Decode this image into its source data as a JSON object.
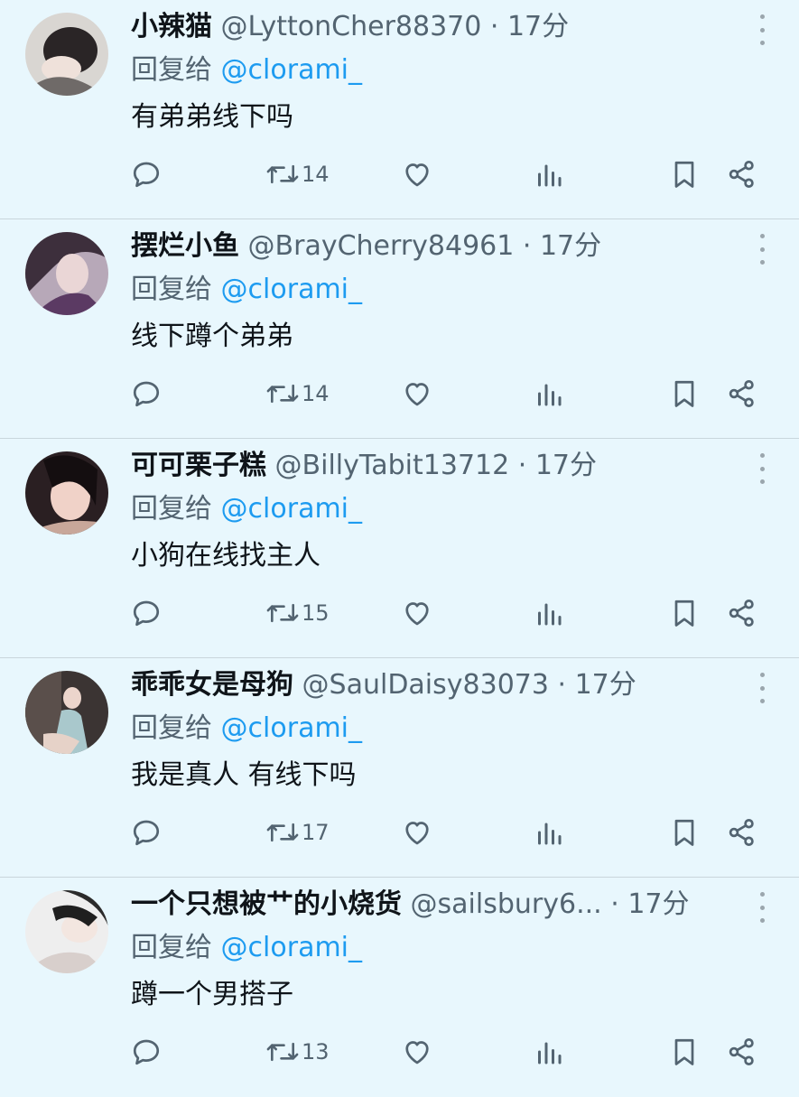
{
  "colors": {
    "background": "#e8f7fd",
    "mention": "#1d9bf0",
    "muted": "#536471",
    "text": "#0f1419"
  },
  "icons": [
    "reply-icon",
    "retweet-icon",
    "like-icon",
    "views-icon",
    "bookmark-icon",
    "share-icon",
    "more-icon"
  ],
  "tweets": [
    {
      "name": "小辣猫",
      "handle": "@LyttonCher88370",
      "sep": " · ",
      "time": "17分",
      "reply_prefix": "回复给 ",
      "reply_to": "@clorami_",
      "text": "有弟弟线下吗",
      "retweets": "14"
    },
    {
      "name": "摆烂小鱼",
      "handle": "@BrayCherry84961",
      "sep": " · ",
      "time": "17分",
      "reply_prefix": "回复给 ",
      "reply_to": "@clorami_",
      "text": "线下蹲个弟弟",
      "retweets": "14"
    },
    {
      "name": "可可栗子糕",
      "handle": "@BillyTabit13712",
      "sep": " · ",
      "time": "17分",
      "reply_prefix": "回复给 ",
      "reply_to": "@clorami_",
      "text": "小狗在线找主人",
      "retweets": "15"
    },
    {
      "name": "乖乖女是母狗",
      "handle": "@SaulDaisy83073",
      "sep": " · ",
      "time": "17分",
      "reply_prefix": "回复给 ",
      "reply_to": "@clorami_",
      "text": "我是真人 有线下吗",
      "retweets": "17"
    },
    {
      "name": "一个只想被艹的小烧货",
      "handle": "@sailsbury6...",
      "sep": " · ",
      "time": "17分",
      "reply_prefix": "回复给 ",
      "reply_to": "@clorami_",
      "text": "蹲一个男搭子",
      "retweets": "13"
    }
  ]
}
